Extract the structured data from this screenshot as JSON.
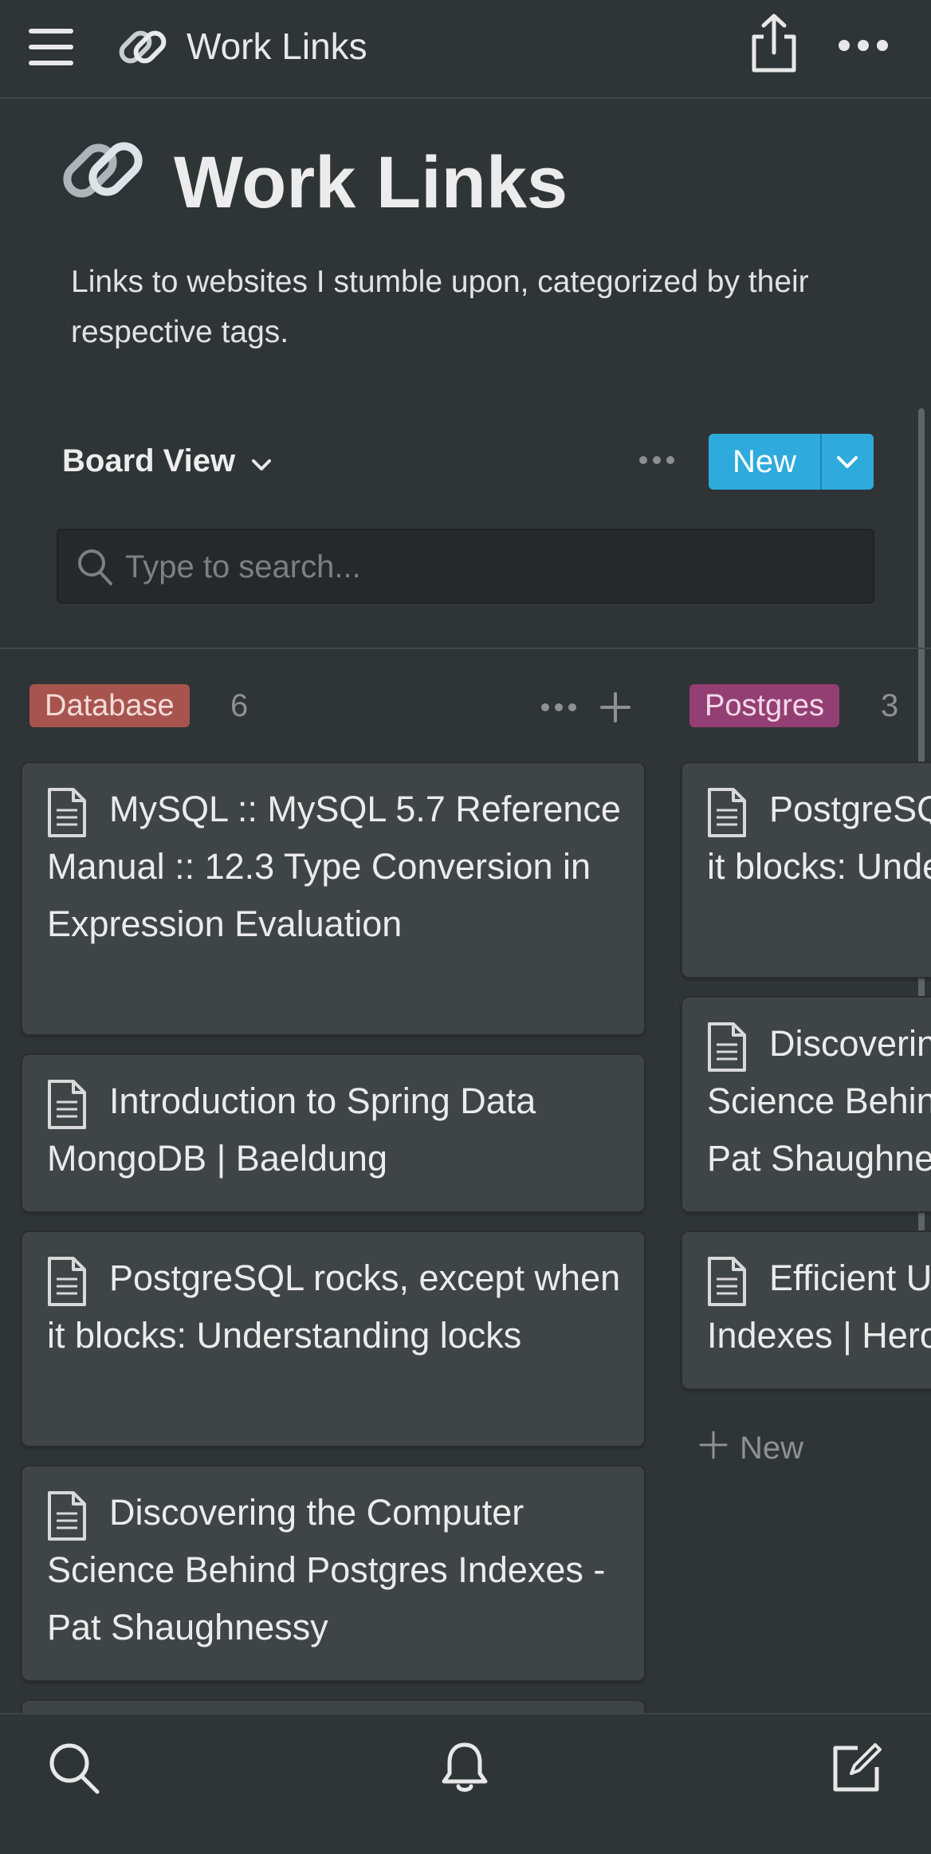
{
  "topbar": {
    "title": "Work Links",
    "page_icon": "link-icon",
    "share_icon": "share-icon",
    "more_icon": "more-icon",
    "menu_icon": "hamburger-icon"
  },
  "header": {
    "title": "Work Links",
    "description": "Links to websites I stumble upon, categorized by their respective tags.",
    "view_label": "Board View",
    "new_label": "New"
  },
  "search": {
    "placeholder": "Type to search..."
  },
  "board": {
    "columns": [
      {
        "tag": "Database",
        "tag_color": "#a8544e",
        "count": "6",
        "cards": [
          "MySQL :: MySQL 5.7 Reference Manual :: 12.3 Type Conversion in Expression Evaluation",
          "Introduction to Spring Data MongoDB | Baeldung",
          "PostgreSQL rocks, except when it blocks: Understanding locks",
          "Discovering the Computer Science Behind Postgres Indexes - Pat Shaughnessy"
        ]
      },
      {
        "tag": "Postgres",
        "tag_color": "#943f73",
        "count": "3",
        "cards": [
          "PostgreSQL rocks, except when it blocks: Understanding locks",
          "Discovering the Computer Science Behind Postgres Indexes - Pat Shaughnessy",
          "Efficient Use of PostgreSQL Indexes | Heroku"
        ],
        "new_label": "New"
      }
    ]
  },
  "bottombar": {
    "search_icon": "search-icon",
    "bell_icon": "bell-icon",
    "compose_icon": "compose-icon"
  },
  "colors": {
    "background": "#2f3437",
    "accent": "#2eaadc",
    "card": "#3f4447"
  }
}
